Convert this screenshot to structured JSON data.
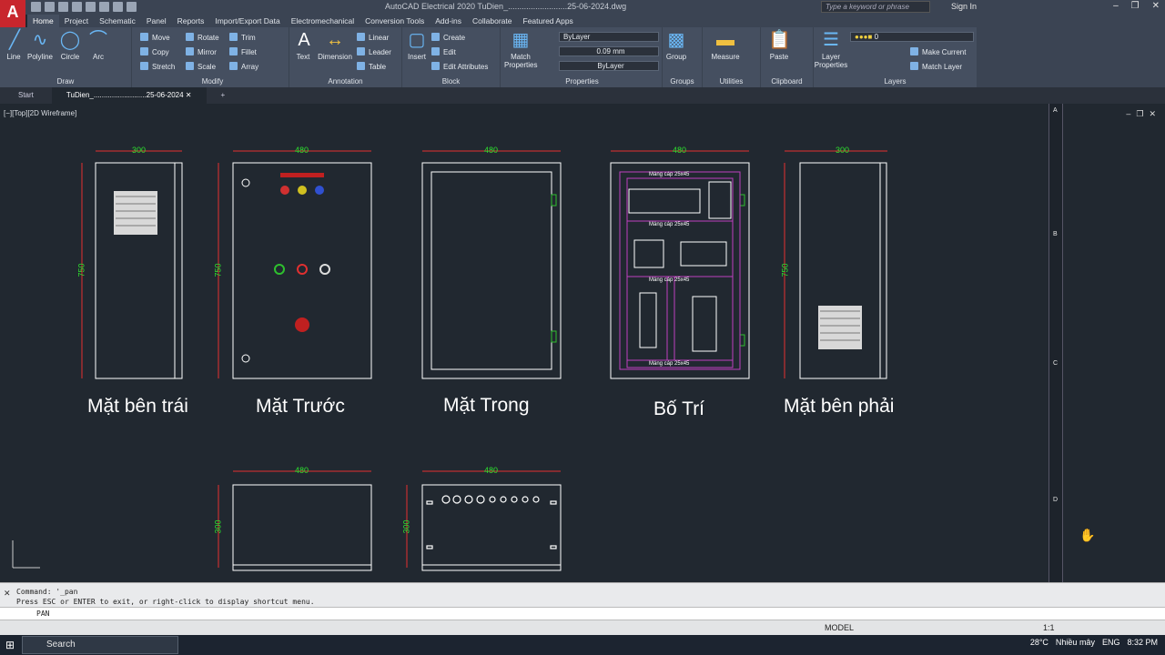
{
  "app": {
    "logo": "A",
    "title": "AutoCAD Electrical 2020   TuDien_..........................25-06-2024.dwg",
    "search_placeholder": "Type a keyword or phrase",
    "signin": "Sign In"
  },
  "ribbon_tabs": [
    "Home",
    "Project",
    "Schematic",
    "Panel",
    "Reports",
    "Import/Export Data",
    "Electromechanical",
    "Conversion Tools",
    "Add-ins",
    "Collaborate",
    "Featured Apps"
  ],
  "draw": {
    "title": "Draw",
    "tools": [
      "Line",
      "Polyline",
      "Circle",
      "Arc"
    ]
  },
  "modify": {
    "title": "Modify",
    "tools": [
      "Move",
      "Rotate",
      "Trim",
      "Copy",
      "Mirror",
      "Fillet",
      "Stretch",
      "Scale",
      "Array"
    ]
  },
  "annotation": {
    "title": "Annotation",
    "tools": [
      "Text",
      "Dimension",
      "Linear",
      "Leader",
      "Table"
    ]
  },
  "block": {
    "title": "Block",
    "tools": [
      "Insert",
      "Create",
      "Edit",
      "Edit Attributes"
    ]
  },
  "properties": {
    "title": "Properties",
    "match": "Match Properties",
    "color": "ByLayer",
    "lineweight": "0.09 mm",
    "linetype": "ByLayer"
  },
  "groups": {
    "title": "Groups",
    "tool": "Group"
  },
  "utilities": {
    "title": "Utilities",
    "tool": "Measure"
  },
  "clipboard": {
    "title": "Clipboard",
    "tool": "Paste"
  },
  "layers": {
    "title": "Layers",
    "layer_props": "Layer Properties",
    "current": "0",
    "make_current": "Make Current",
    "match_layer": "Match Layer"
  },
  "file_tabs": [
    "Start",
    "TuDien_..........................25-06-2024"
  ],
  "viewport_label": "[−][Top][2D Wireframe]",
  "drawing": {
    "views": [
      "Mặt bên trái",
      "Mặt Trước",
      "Mặt Trong",
      "Bố Trí",
      "Mặt bên phải"
    ],
    "dims": {
      "w300": "300",
      "w480": "480",
      "h750": "750",
      "h300": "300"
    },
    "tray_label": "Máng cáp 25x45",
    "ruler": [
      "A",
      "B",
      "C",
      "D"
    ]
  },
  "command": {
    "line1": "Command: '_pan",
    "line2": "Press ESC or ENTER to exit, or right-click to display shortcut menu.",
    "prompt": "PAN"
  },
  "status": {
    "model": "MODEL",
    "scale": "1:1"
  },
  "taskbar": {
    "search": "Search",
    "temp": "28°C",
    "weather": "Nhiều mây",
    "lang": "ENG",
    "time": "8:32 PM"
  }
}
